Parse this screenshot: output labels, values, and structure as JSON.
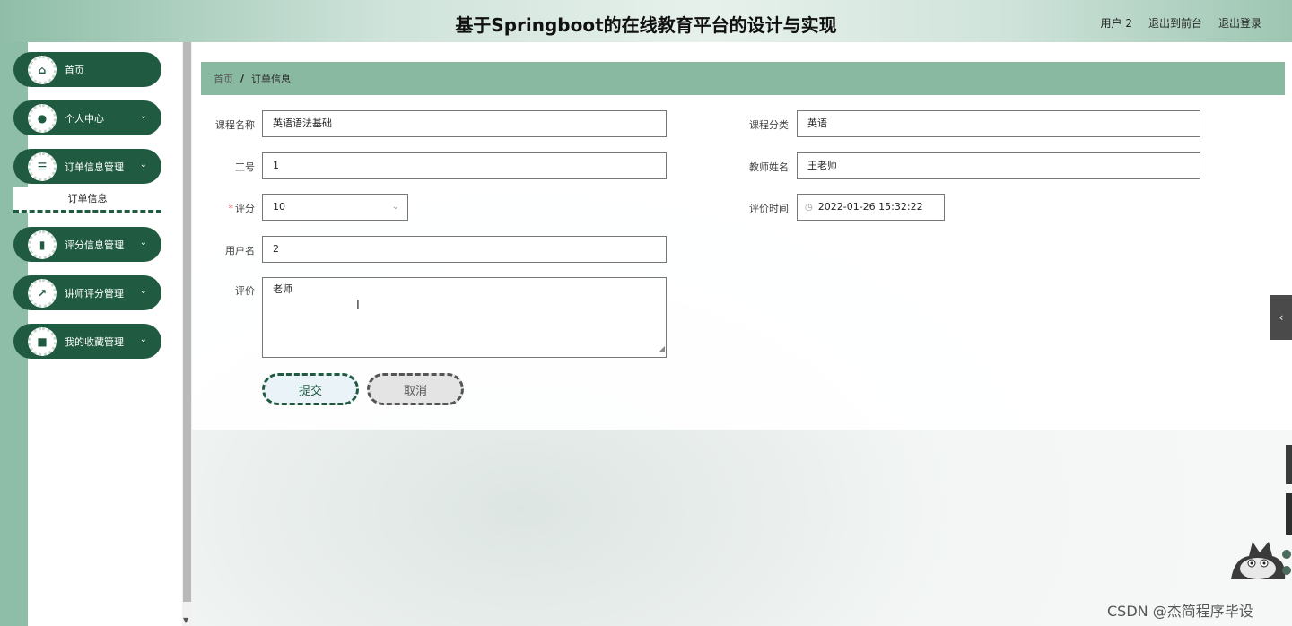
{
  "header": {
    "title": "基于Springboot的在线教育平台的设计与实现",
    "links": [
      "用户 2",
      "退出到前台",
      "退出登录"
    ]
  },
  "sidebar": {
    "items": [
      {
        "label": "首页",
        "icon": "home-icon",
        "glyph": "⌂",
        "expandable": false
      },
      {
        "label": "个人中心",
        "icon": "user-icon",
        "glyph": "●",
        "expandable": true
      },
      {
        "label": "订单信息管理",
        "icon": "list-icon",
        "glyph": "☰",
        "expandable": true
      },
      {
        "label": "评分信息管理",
        "icon": "chart-icon",
        "glyph": "▮",
        "expandable": true
      },
      {
        "label": "讲师评分管理",
        "icon": "trend-icon",
        "glyph": "↗",
        "expandable": true
      },
      {
        "label": "我的收藏管理",
        "icon": "wallet-icon",
        "glyph": "■",
        "expandable": true
      }
    ],
    "submenu": {
      "label": "订单信息"
    }
  },
  "breadcrumb": {
    "home": "首页",
    "separator": "/",
    "current": "订单信息"
  },
  "form": {
    "course_name": {
      "label": "课程名称",
      "value": "英语语法基础"
    },
    "course_category": {
      "label": "课程分类",
      "value": "英语"
    },
    "employee_id": {
      "label": "工号",
      "value": "1"
    },
    "teacher_name": {
      "label": "教师姓名",
      "value": "王老师"
    },
    "score": {
      "label": "评分",
      "value": "10",
      "required_mark": "*"
    },
    "eval_time": {
      "label": "评价时间",
      "value": "2022-01-26 15:32:22"
    },
    "username": {
      "label": "用户名",
      "value": "2"
    },
    "evaluation": {
      "label": "评价",
      "value": "老师"
    }
  },
  "buttons": {
    "submit": "提交",
    "cancel": "取消"
  },
  "watermark": "CSDN @杰简程序毕设",
  "colors": {
    "primary": "#1f5a41",
    "accent": "#8ab9a1"
  }
}
